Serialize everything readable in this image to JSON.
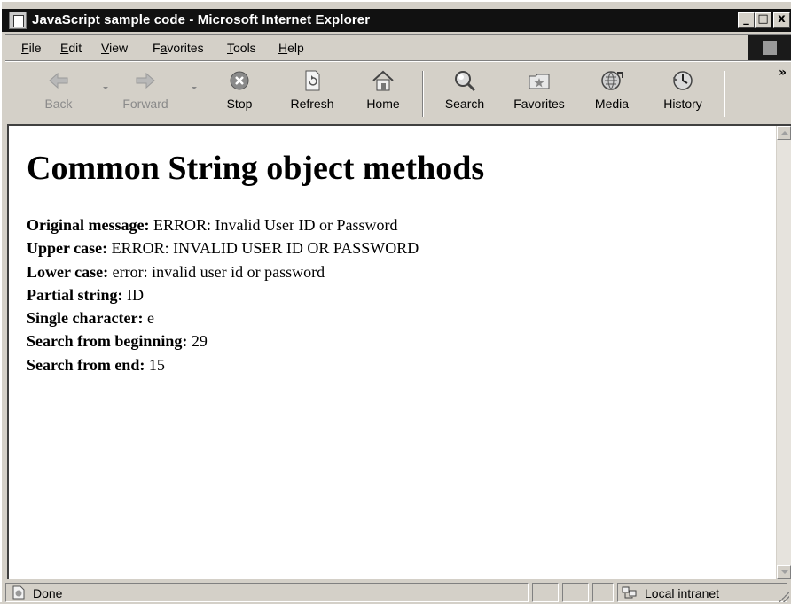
{
  "window": {
    "title": "JavaScript sample code - Microsoft Internet Explorer",
    "controls": {
      "minimize": "_",
      "maximize": "□",
      "close": "x"
    }
  },
  "menu": {
    "items": [
      {
        "label": "File",
        "underline": "F",
        "rest": "ile"
      },
      {
        "label": "Edit",
        "underline": "E",
        "rest": "dit"
      },
      {
        "label": "View",
        "underline": "V",
        "rest": "iew"
      },
      {
        "label": "Favorites",
        "pre": "F",
        "underline": "a",
        "rest": "vorites"
      },
      {
        "label": "Tools",
        "underline": "T",
        "rest": "ools"
      },
      {
        "label": "Help",
        "underline": "H",
        "rest": "elp"
      }
    ]
  },
  "toolbar": {
    "chevron": "»",
    "buttons": [
      {
        "label": "Back",
        "icon": "back-arrow-icon",
        "enabled": false
      },
      {
        "label": "Forward",
        "icon": "forward-arrow-icon",
        "enabled": false
      },
      {
        "label": "Stop",
        "icon": "stop-icon",
        "enabled": true
      },
      {
        "label": "Refresh",
        "icon": "refresh-icon",
        "enabled": true
      },
      {
        "label": "Home",
        "icon": "home-icon",
        "enabled": true
      },
      {
        "label": "Search",
        "icon": "search-icon",
        "enabled": true
      },
      {
        "label": "Favorites",
        "icon": "favorites-icon",
        "enabled": true
      },
      {
        "label": "Media",
        "icon": "media-icon",
        "enabled": true
      },
      {
        "label": "History",
        "icon": "history-icon",
        "enabled": true
      }
    ]
  },
  "page": {
    "heading": "Common String object methods",
    "results": [
      {
        "label": "Original message:",
        "value": "ERROR: Invalid User ID or Password"
      },
      {
        "label": "Upper case:",
        "value": "ERROR: INVALID USER ID OR PASSWORD"
      },
      {
        "label": "Lower case:",
        "value": "error: invalid user id or password"
      },
      {
        "label": "Partial string:",
        "value": "ID"
      },
      {
        "label": "Single character:",
        "value": "e"
      },
      {
        "label": "Search from beginning:",
        "value": "29"
      },
      {
        "label": "Search from end:",
        "value": "15"
      }
    ]
  },
  "status": {
    "text": "Done",
    "zone": "Local intranet"
  }
}
